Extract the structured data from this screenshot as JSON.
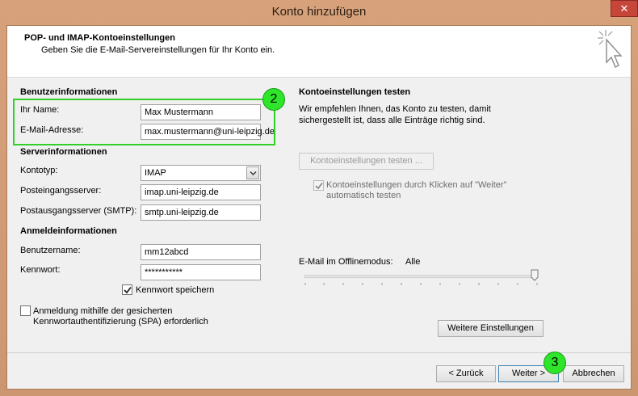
{
  "window": {
    "title": "Konto hinzufügen",
    "close_glyph": "✕"
  },
  "header": {
    "title": "POP- und IMAP-Kontoeinstellungen",
    "subtitle": "Geben Sie die E-Mail-Servereinstellungen für Ihr Konto ein."
  },
  "user_info": {
    "heading": "Benutzerinformationen",
    "name_label": "Ihr Name:",
    "name_value": "Max Mustermann",
    "email_label": "E-Mail-Adresse:",
    "email_value": "max.mustermann@uni-leipzig.de"
  },
  "server_info": {
    "heading": "Serverinformationen",
    "account_type_label": "Kontotyp:",
    "account_type_value": "IMAP",
    "incoming_label": "Posteingangsserver:",
    "incoming_value": "imap.uni-leipzig.de",
    "outgoing_label": "Postausgangsserver (SMTP):",
    "outgoing_value": "smtp.uni-leipzig.de"
  },
  "login_info": {
    "heading": "Anmeldeinformationen",
    "username_label": "Benutzername:",
    "username_value": "mm12abcd",
    "password_label": "Kennwort:",
    "password_value": "***********",
    "remember_label": "Kennwort speichern",
    "remember_checked": true,
    "spa_label_line1": "Anmeldung mithilfe der gesicherten",
    "spa_label_line2": "Kennwortauthentifizierung (SPA) erforderlich",
    "spa_checked": false
  },
  "test": {
    "heading": "Kontoeinstellungen testen",
    "description_line1": "Wir empfehlen Ihnen, das Konto zu testen, damit",
    "description_line2": "sichergestellt ist, dass alle Einträge richtig sind.",
    "test_button": "Kontoeinstellungen testen ...",
    "auto_test_line1": "Kontoeinstellungen durch Klicken auf \"Weiter\"",
    "auto_test_line2": "automatisch testen",
    "auto_test_checked": true
  },
  "offline": {
    "label": "E-Mail im Offlinemodus:",
    "value": "Alle",
    "slider_level": 1.0
  },
  "buttons": {
    "more_settings": "Weitere Einstellungen",
    "back": "< Zurück",
    "next": "Weiter >",
    "cancel": "Abbrechen"
  },
  "annotations": {
    "badge_2": "2",
    "badge_3": "3",
    "highlight_color": "#34d02a"
  }
}
